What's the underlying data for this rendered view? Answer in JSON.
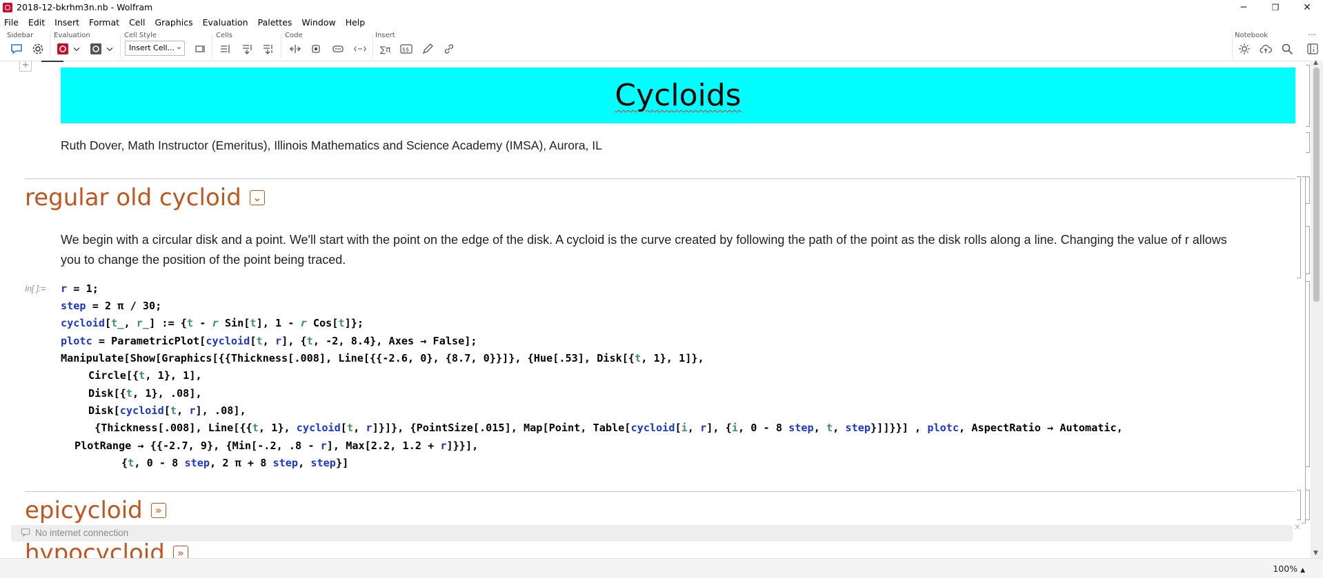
{
  "window": {
    "title": "2018-12-bkrhm3n.nb - Wolfram",
    "minimize": "─",
    "restore": "❐",
    "close": "✕"
  },
  "menu": [
    "File",
    "Edit",
    "Insert",
    "Format",
    "Cell",
    "Graphics",
    "Evaluation",
    "Palettes",
    "Window",
    "Help"
  ],
  "toolbar": {
    "groups": {
      "sidebar": "Sidebar",
      "evaluation": "Evaluation",
      "cell_style": "Cell Style",
      "cells": "Cells",
      "code": "Code",
      "insert": "Insert",
      "notebook": "Notebook"
    },
    "cell_style_value": "Insert Cell...",
    "more": "⋯"
  },
  "notebook": {
    "title": "Cycloids",
    "author": "Ruth Dover, Math Instructor (Emeritus), Illinois Mathematics and Science Academy (IMSA), Aurora, IL",
    "section1": "regular old cycloid",
    "paragraph": "We begin with a circular disk and a point.  We'll start with the point on the edge of the disk.  A cycloid is the curve created by following the path of the point as the disk rolls along a line.  Changing the value of r allows you to change the position of the point being traced.",
    "input_label": "In[ ]:=",
    "code_lines": [
      "r = 1;",
      "step = 2 π / 30;",
      "cycloid[t_, r_] := {t - r Sin[t], 1 - r Cos[t]};",
      "plotc = ParametricPlot[cycloid[t, r], {t, -2, 8.4}, Axes → False];",
      "Manipulate[Show[Graphics[{{Thickness[.008], Line[{{-2.6, 0}, {8.7, 0}}]}, {Hue[.53], Disk[{t, 1}, 1]},",
      "    Circle[{t, 1}, 1],",
      "    Disk[{t, 1}, .08],",
      "    Disk[cycloid[t, r], .08],",
      "     {Thickness[.008], Line[{{t, 1}, cycloid[t, r]}]}, {PointSize[.015], Map[Point, Table[cycloid[i, r], {i, 0 - 8 step, t, step}]]}}] , plotc, AspectRatio → Automatic,",
      "  PlotRange → {{-2.7, 9}, {Min[-.2, .8 - r], Max[2.2, 1.2 + r]}}],",
      "       {t, 0 - 8 step, 2 π + 8 step, step}]"
    ],
    "section2": "epicycloid",
    "section3": "hypocycloid"
  },
  "notification": {
    "text": "No internet connection",
    "close": "✕"
  },
  "status": {
    "zoom": "100%"
  },
  "colors": {
    "title_bg": "#00ffff",
    "section": "#c0561f",
    "user_symbol": "#1c37c8",
    "local_var": "#3f8f6b"
  }
}
